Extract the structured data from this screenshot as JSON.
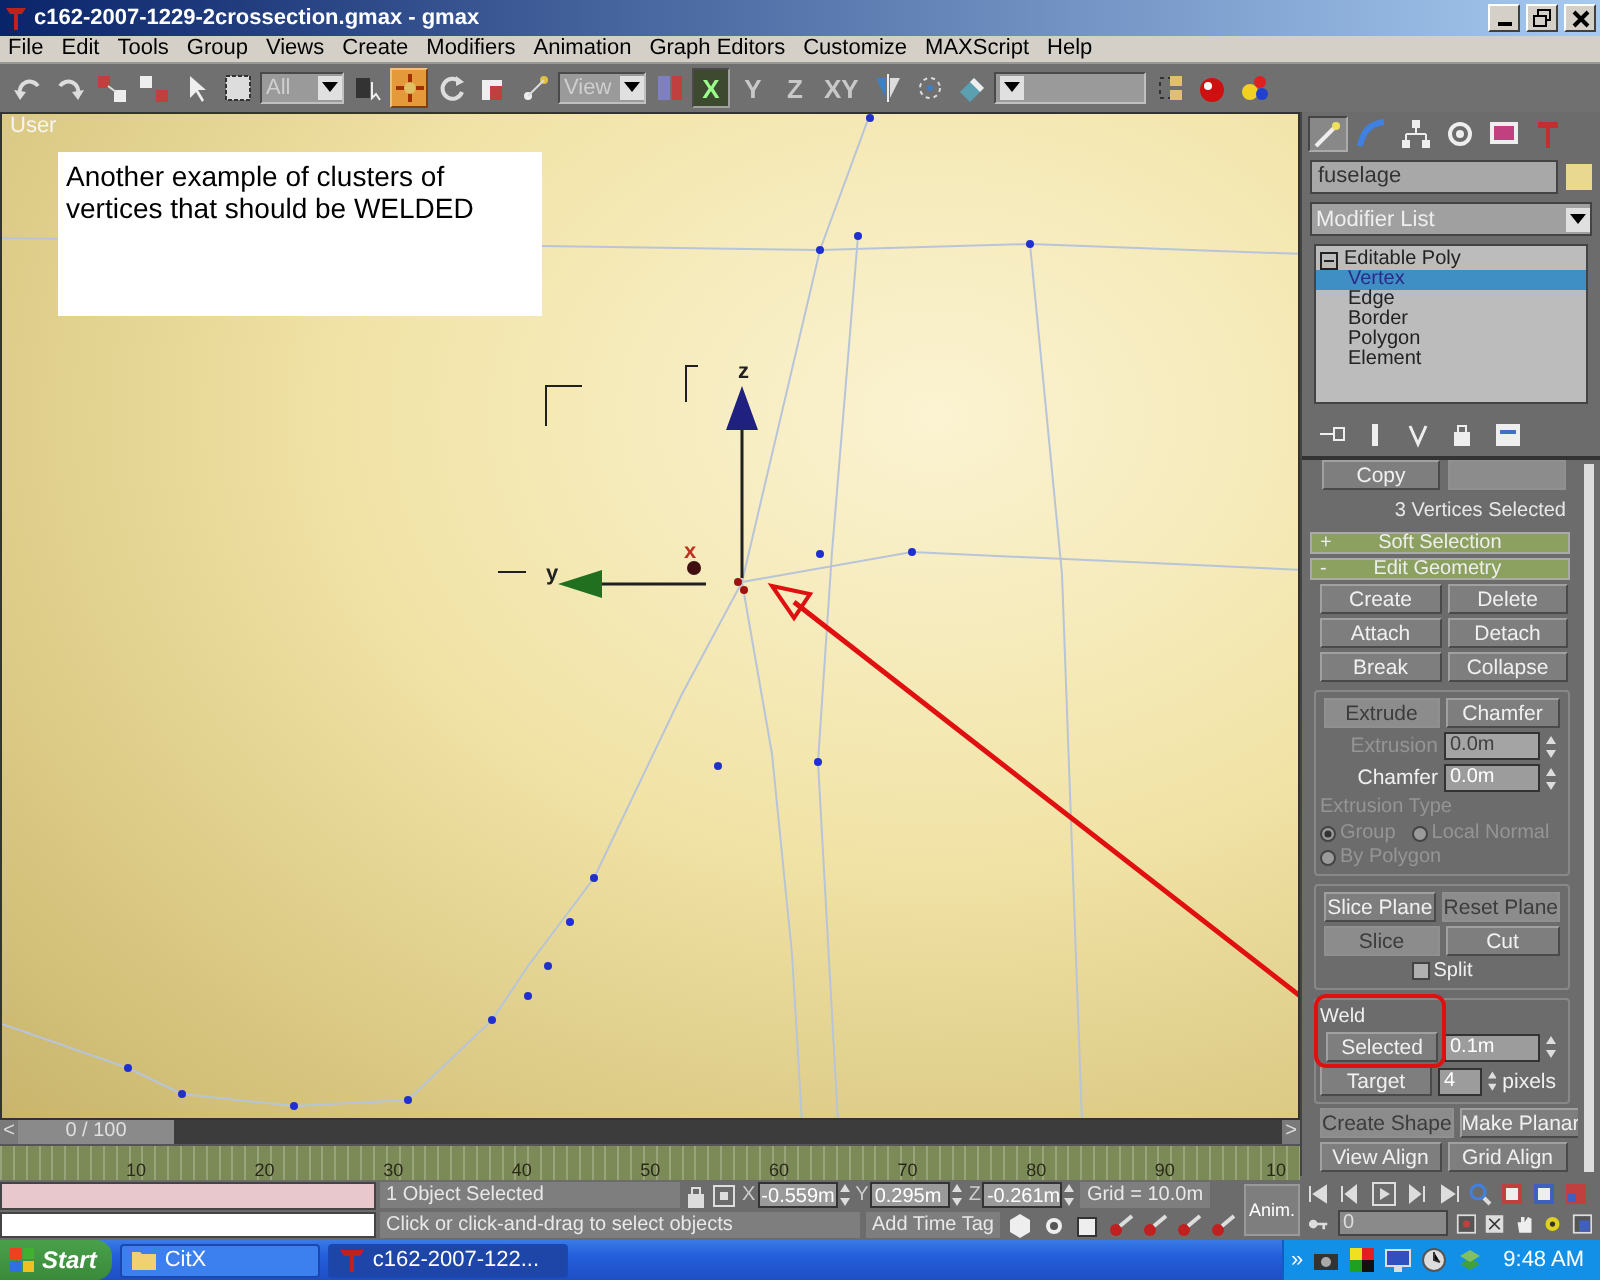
{
  "window": {
    "title": "c162-2007-1229-2crossection.gmax - gmax"
  },
  "menu": [
    "File",
    "Edit",
    "Tools",
    "Group",
    "Views",
    "Create",
    "Modifiers",
    "Animation",
    "Graph Editors",
    "Customize",
    "MAXScript",
    "Help"
  ],
  "toolbar": [
    {
      "kind": "icon",
      "selected": false
    },
    {
      "kind": "icon",
      "selected": false
    },
    {
      "kind": "icon",
      "selected": false
    },
    {
      "kind": "icon",
      "selected": false
    },
    {
      "kind": "icon",
      "selected": false
    },
    {
      "kind": "icon",
      "selected": false
    },
    {
      "kind": "dropdown",
      "value": "All"
    },
    {
      "kind": "icon",
      "selected": false
    },
    {
      "kind": "icon",
      "selected": true
    },
    {
      "kind": "icon",
      "selected": false
    },
    {
      "kind": "icon",
      "selected": false
    },
    {
      "kind": "icon",
      "selected": false
    },
    {
      "kind": "dropdown",
      "value": "View"
    },
    {
      "kind": "icon",
      "selected": false
    },
    {
      "kind": "axis",
      "label": "X",
      "selected": true
    },
    {
      "kind": "axis",
      "label": "Y",
      "selected": false
    },
    {
      "kind": "axis",
      "label": "Z",
      "selected": false
    },
    {
      "kind": "axis",
      "label": "XY",
      "selected": false
    },
    {
      "kind": "icon",
      "selected": false
    },
    {
      "kind": "icon",
      "selected": false
    },
    {
      "kind": "icon",
      "selected": false
    },
    {
      "kind": "dropdown"
    },
    {
      "kind": "icon",
      "selected": false
    },
    {
      "kind": "icon",
      "selected": false
    },
    {
      "kind": "icon",
      "selected": false
    }
  ],
  "viewport": {
    "label": "User",
    "note": "Another example of clusters of vertices that should be WELDED",
    "gizmo": {
      "z_label": "z",
      "y_label": "y",
      "x_label": "x"
    }
  },
  "command_panel": {
    "tabs": [
      {
        "selected": true
      },
      {
        "selected": false
      },
      {
        "selected": false
      },
      {
        "selected": false
      },
      {
        "selected": false
      },
      {
        "selected": false
      }
    ],
    "object_name": "fuselage",
    "modifier_list": "Modifier List",
    "stack": [
      {
        "label": "Editable Poly",
        "expanded": true,
        "selected": false,
        "children": [
          {
            "label": "Vertex",
            "selected": true
          },
          {
            "label": "Edge",
            "selected": false
          },
          {
            "label": "Border",
            "selected": false
          },
          {
            "label": "Polygon",
            "selected": false
          },
          {
            "label": "Element",
            "selected": false
          }
        ]
      }
    ],
    "cut_buttons": [
      {
        "label": "Copy",
        "disabled": false
      },
      {
        "disabled": true
      }
    ],
    "selection_info": "3 Vertices Selected",
    "rollouts": [
      {
        "sign": "+",
        "title": "Soft Selection"
      },
      {
        "sign": "-",
        "title": "Edit Geometry"
      }
    ],
    "edit_geometry": {
      "button_rows": [
        [
          {
            "label": "Create",
            "disabled": false
          },
          {
            "label": "Delete",
            "disabled": false
          }
        ],
        [
          {
            "label": "Attach",
            "disabled": false
          },
          {
            "label": "Detach",
            "disabled": false
          }
        ],
        [
          {
            "label": "Break",
            "disabled": false
          },
          {
            "label": "Collapse",
            "disabled": false
          }
        ]
      ],
      "extrude_group": {
        "buttons": [
          {
            "label": "Extrude",
            "disabled": true
          },
          {
            "label": "Chamfer",
            "disabled": false
          }
        ],
        "fields": [
          {
            "label": "Extrusion",
            "value": "0.0m",
            "disabled": true
          },
          {
            "label": "Chamfer",
            "value": "0.0m",
            "disabled": false
          }
        ],
        "type_label": "Extrusion Type",
        "disabled": true,
        "radios": [
          {
            "label": "Group",
            "selected": true
          },
          {
            "label": "Local Normal",
            "selected": false
          },
          {
            "label": "By Polygon",
            "selected": false
          }
        ]
      },
      "slice_group": {
        "button_rows": [
          [
            {
              "label": "Slice Plane",
              "disabled": false
            },
            {
              "label": "Reset Plane",
              "disabled": true
            }
          ],
          [
            {
              "label": "Slice",
              "disabled": true
            },
            {
              "label": "Cut",
              "disabled": false
            }
          ]
        ],
        "split": {
          "label": "Split",
          "checked": false
        }
      },
      "weld_group": {
        "title": "Weld",
        "highlighted": true,
        "selected_button": "Selected",
        "threshold": "0.1m",
        "target_button": "Target",
        "pixels": "4",
        "pixels_unit": "pixels"
      },
      "bottom_rows": [
        [
          {
            "label": "Create Shape",
            "disabled": true
          },
          {
            "label": "Make Planar",
            "disabled": false
          }
        ],
        [
          {
            "label": "View Align",
            "disabled": false
          },
          {
            "label": "Grid Align",
            "disabled": false
          }
        ]
      ]
    }
  },
  "timeline": {
    "level": 0,
    "prev": "<",
    "next": ">",
    "slider": "0 / 100",
    "ticks": [
      "10",
      "20",
      "30",
      "40",
      "50",
      "60",
      "70",
      "80",
      "90",
      "10"
    ]
  },
  "status": {
    "selection": "1 Object Selected",
    "prompt": "Click or click-and-drag to select objects",
    "coords": [
      {
        "axis": "X",
        "value": "-0.559m"
      },
      {
        "axis": "Y",
        "value": "0.295m"
      },
      {
        "axis": "Z",
        "value": "-0.261m"
      }
    ],
    "grid": "Grid = 10.0m",
    "add_time_tag": "Add Time Tag",
    "anim_button": "Anim."
  },
  "playback": {
    "frame": "0"
  },
  "taskbar": {
    "start": "Start",
    "tray_arrow": "»",
    "tasks": [
      {
        "label": "CitX",
        "selected": false
      },
      {
        "label": "c162-2007-122...",
        "selected": true
      }
    ],
    "clock": "9:48 AM"
  }
}
